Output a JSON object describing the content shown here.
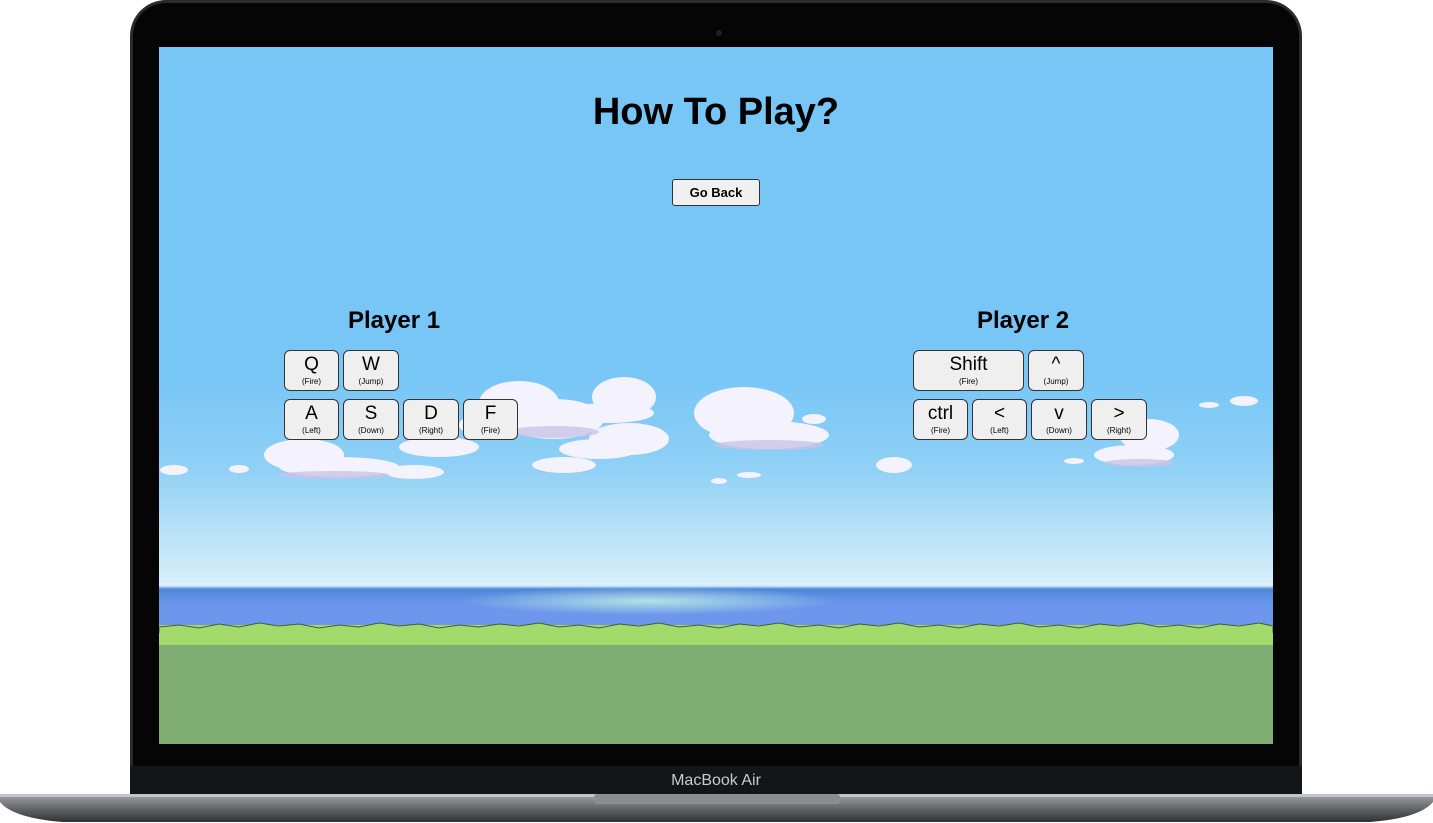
{
  "device": {
    "brand_label": "MacBook Air"
  },
  "page": {
    "title": "How To Play?",
    "back_button": "Go Back"
  },
  "players": [
    {
      "title": "Player 1",
      "keys": [
        {
          "key": "Q",
          "action": "(Fire)"
        },
        {
          "key": "W",
          "action": "(Jump)"
        },
        {
          "key": "A",
          "action": "(Left)"
        },
        {
          "key": "S",
          "action": "(Down)"
        },
        {
          "key": "D",
          "action": "(Right)"
        },
        {
          "key": "F",
          "action": "(Fire)"
        }
      ]
    },
    {
      "title": "Player 2",
      "keys": [
        {
          "key": "Shift",
          "action": "(Fire)"
        },
        {
          "key": "^",
          "action": "(Jump)"
        },
        {
          "key": "ctrl",
          "action": "(Fire)"
        },
        {
          "key": "<",
          "action": "(Left)"
        },
        {
          "key": "v",
          "action": "(Down)"
        },
        {
          "key": ">",
          "action": "(Right)"
        }
      ]
    }
  ],
  "colors": {
    "sky": "#77c6f6",
    "sea": "#6a96ea",
    "grass": "#a4d96c",
    "ground": "#80ad72",
    "laptop_frame": "#2a2b2e"
  }
}
